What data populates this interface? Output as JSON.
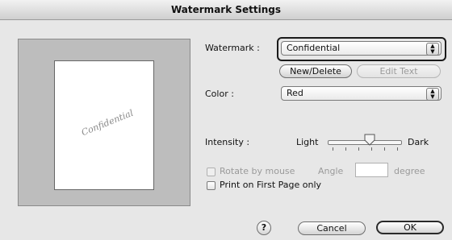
{
  "window": {
    "title": "Watermark Settings"
  },
  "preview": {
    "watermark_text": "Confidential"
  },
  "watermark": {
    "label": "Watermark :",
    "selected": "Confidential",
    "new_delete_label": "New/Delete",
    "edit_text_label": "Edit Text"
  },
  "color": {
    "label": "Color :",
    "selected": "Red"
  },
  "intensity": {
    "label": "Intensity :",
    "min_label": "Light",
    "max_label": "Dark",
    "level_fraction": 0.55
  },
  "rotate": {
    "label": "Rotate by mouse",
    "angle_label": "Angle",
    "angle_value": "",
    "unit_label": "degree"
  },
  "first_page": {
    "label": "Print on First Page only"
  },
  "footer": {
    "help_label": "?",
    "cancel_label": "Cancel",
    "ok_label": "OK"
  },
  "icons": {
    "select_arrow": "updown-arrows-icon",
    "help": "help-icon"
  },
  "colors": {
    "background": "#e7e7e7",
    "preview_bg": "#bdbdbd",
    "watermark_text": "#8a8a8a"
  }
}
